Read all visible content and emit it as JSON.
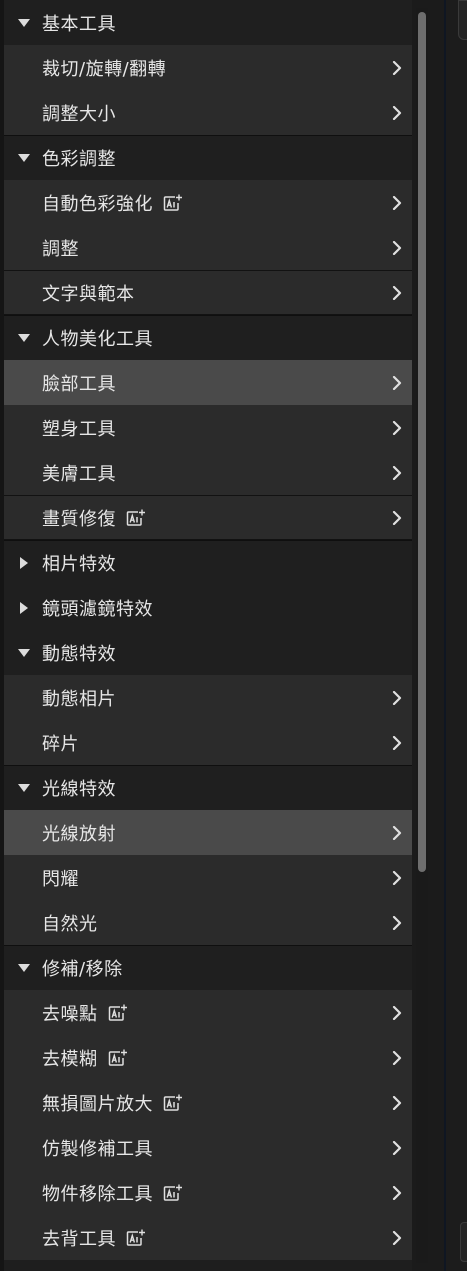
{
  "menu": [
    {
      "type": "header",
      "label": "基本工具",
      "expanded": true
    },
    {
      "type": "item",
      "label": "裁切/旋轉/翻轉",
      "ai": false
    },
    {
      "type": "item",
      "label": "調整大小",
      "ai": false
    },
    {
      "type": "header",
      "label": "色彩調整",
      "expanded": true
    },
    {
      "type": "item",
      "label": "自動色彩強化",
      "ai": true
    },
    {
      "type": "item",
      "label": "調整",
      "ai": false
    },
    {
      "type": "single",
      "label": "文字與範本",
      "ai": false
    },
    {
      "type": "header",
      "label": "人物美化工具",
      "expanded": true
    },
    {
      "type": "item",
      "label": "臉部工具",
      "ai": false,
      "selected": true
    },
    {
      "type": "item",
      "label": "塑身工具",
      "ai": false
    },
    {
      "type": "item",
      "label": "美膚工具",
      "ai": false
    },
    {
      "type": "single",
      "label": "畫質修復",
      "ai": true
    },
    {
      "type": "header",
      "label": "相片特效",
      "expanded": false
    },
    {
      "type": "header",
      "label": "鏡頭濾鏡特效",
      "expanded": false
    },
    {
      "type": "header",
      "label": "動態特效",
      "expanded": true
    },
    {
      "type": "item",
      "label": "動態相片",
      "ai": false
    },
    {
      "type": "item",
      "label": "碎片",
      "ai": false
    },
    {
      "type": "header",
      "label": "光線特效",
      "expanded": true
    },
    {
      "type": "item",
      "label": "光線放射",
      "ai": false,
      "selected": true
    },
    {
      "type": "item",
      "label": "閃耀",
      "ai": false
    },
    {
      "type": "item",
      "label": "自然光",
      "ai": false
    },
    {
      "type": "header",
      "label": "修補/移除",
      "expanded": true
    },
    {
      "type": "item",
      "label": "去噪點",
      "ai": true
    },
    {
      "type": "item",
      "label": "去模糊",
      "ai": true
    },
    {
      "type": "item",
      "label": "無損圖片放大",
      "ai": true
    },
    {
      "type": "item",
      "label": "仿製修補工具",
      "ai": false
    },
    {
      "type": "item",
      "label": "物件移除工具",
      "ai": true
    },
    {
      "type": "item",
      "label": "去背工具",
      "ai": true
    }
  ],
  "colors": {
    "accent": "#4a4a4a",
    "item_bg": "#2b2b2b",
    "header_bg": "#1f1f1f"
  },
  "icons": {
    "expanded": "caret-down-icon",
    "collapsed": "caret-right-icon",
    "chevron": "chevron-right-icon",
    "ai": "ai-sparkle-icon"
  }
}
